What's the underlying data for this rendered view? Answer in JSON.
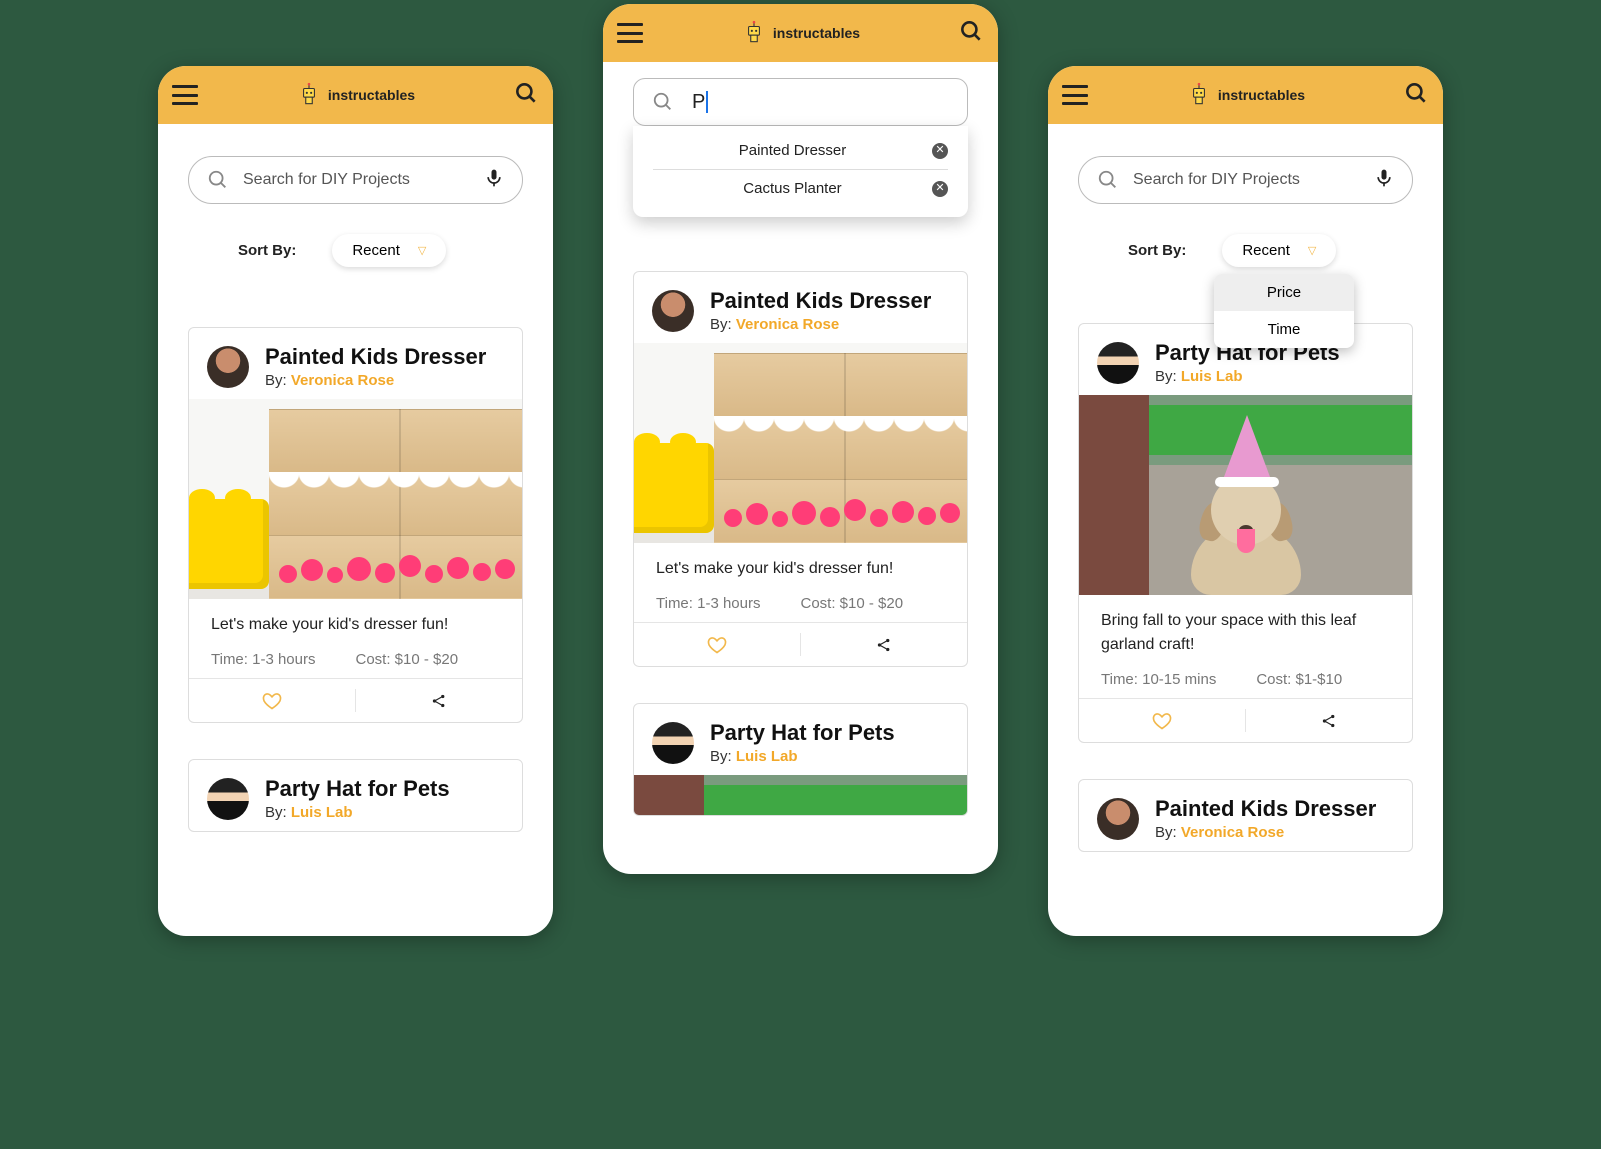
{
  "brand": "instructables",
  "search": {
    "placeholder": "Search for DIY Projects",
    "typed_value": "P",
    "suggestions": [
      "Painted Dresser",
      "Cactus Planter"
    ]
  },
  "sort": {
    "label": "Sort By:",
    "selected": "Recent",
    "options": [
      "Price",
      "Time"
    ]
  },
  "cards": {
    "dresser": {
      "title": "Painted Kids Dresser",
      "by_prefix": "By: ",
      "author": "Veronica Rose",
      "desc": "Let's make your kid's dresser fun!",
      "time": "Time: 1-3 hours",
      "cost": "Cost: $10 - $20"
    },
    "pets": {
      "title": "Party Hat for Pets",
      "by_prefix": "By: ",
      "author": "Luis Lab",
      "desc": "Bring fall to your space with this leaf garland craft!",
      "time": "Time: 10-15 mins",
      "cost": "Cost: $1-$10"
    }
  }
}
